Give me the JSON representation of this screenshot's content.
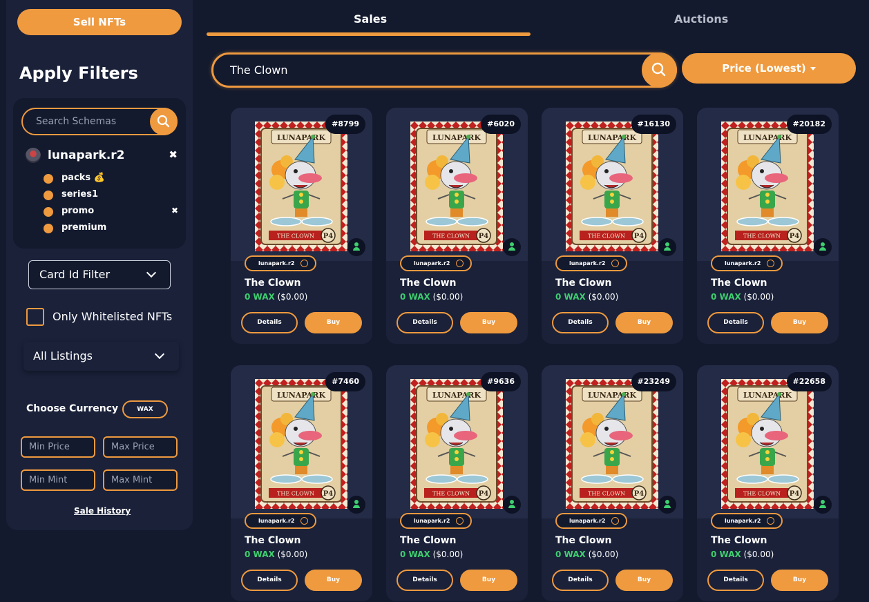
{
  "sidebar": {
    "sell_label": "Sell NFTs",
    "filters_title": "Apply Filters",
    "schema_search_placeholder": "Search Schemas",
    "collection": "lunapark.r2",
    "schemas": [
      {
        "label": "packs",
        "badge": "💰",
        "removable": false
      },
      {
        "label": "series1",
        "badge": "",
        "removable": false
      },
      {
        "label": "promo",
        "badge": "",
        "removable": true
      },
      {
        "label": "premium",
        "badge": "",
        "removable": false
      }
    ],
    "card_id_filter": "Card Id Filter",
    "whitelist_label": "Only Whitelisted NFTs",
    "listings_select": "All Listings",
    "currency_label": "Choose Currency",
    "currency_value": "WAX",
    "min_price": "Min Price",
    "max_price": "Max Price",
    "min_mint": "Min Mint",
    "max_mint": "Max Mint",
    "sale_history": "Sale History"
  },
  "tabs": {
    "sales": "Sales",
    "auctions": "Auctions",
    "active": "sales"
  },
  "search": {
    "value": "The Clown"
  },
  "sort": {
    "label": "Price (Lowest)"
  },
  "cards": [
    {
      "mint": "#8799",
      "collection": "lunapark.r2",
      "name": "The Clown",
      "price": "0 WAX",
      "usd": "($0.00)",
      "details": "Details",
      "buy": "Buy"
    },
    {
      "mint": "#6020",
      "collection": "lunapark.r2",
      "name": "The Clown",
      "price": "0 WAX",
      "usd": "($0.00)",
      "details": "Details",
      "buy": "Buy"
    },
    {
      "mint": "#16130",
      "collection": "lunapark.r2",
      "name": "The Clown",
      "price": "0 WAX",
      "usd": "($0.00)",
      "details": "Details",
      "buy": "Buy"
    },
    {
      "mint": "#20182",
      "collection": "lunapark.r2",
      "name": "The Clown",
      "price": "0 WAX",
      "usd": "($0.00)",
      "details": "Details",
      "buy": "Buy"
    },
    {
      "mint": "#7460",
      "collection": "lunapark.r2",
      "name": "The Clown",
      "price": "0 WAX",
      "usd": "($0.00)",
      "details": "Details",
      "buy": "Buy"
    },
    {
      "mint": "#9636",
      "collection": "lunapark.r2",
      "name": "The Clown",
      "price": "0 WAX",
      "usd": "($0.00)",
      "details": "Details",
      "buy": "Buy"
    },
    {
      "mint": "#23249",
      "collection": "lunapark.r2",
      "name": "The Clown",
      "price": "0 WAX",
      "usd": "($0.00)",
      "details": "Details",
      "buy": "Buy"
    },
    {
      "mint": "#22658",
      "collection": "lunapark.r2",
      "name": "The Clown",
      "price": "0 WAX",
      "usd": "($0.00)",
      "details": "Details",
      "buy": "Buy"
    }
  ],
  "nft_art": {
    "logo_text": "LUNAPARK",
    "banner_text": "THE CLOWN",
    "tag": "P4"
  },
  "colors": {
    "accent": "#ef9a3f",
    "background": "#131a2e",
    "panel": "#1a2139",
    "price_green": "#3ecf6f"
  },
  "icons": {
    "search": "search-icon",
    "close": "close-icon",
    "chevron": "chevron-down-icon",
    "owner": "user-icon",
    "verified": "verified-icon"
  }
}
